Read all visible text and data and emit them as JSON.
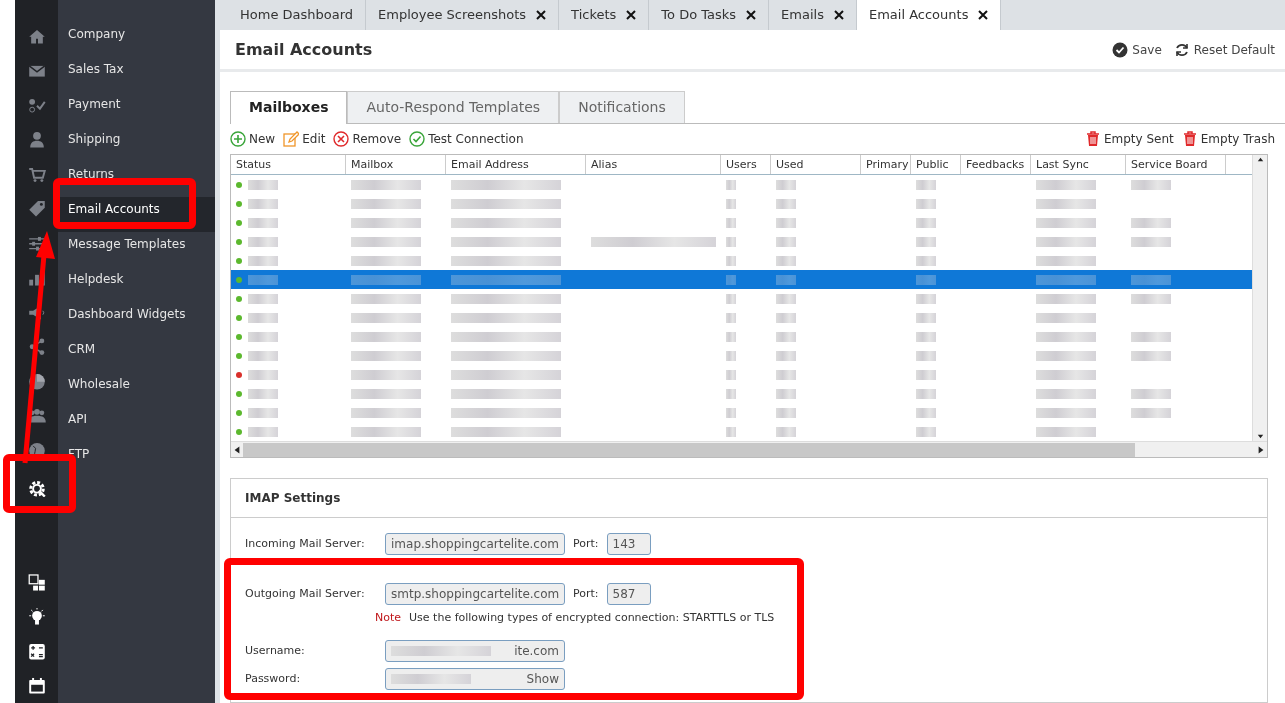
{
  "sidebar": {
    "items": [
      {
        "label": "Company",
        "selected": false
      },
      {
        "label": "Sales Tax",
        "selected": false
      },
      {
        "label": "Payment",
        "selected": false
      },
      {
        "label": "Shipping",
        "selected": false
      },
      {
        "label": "Returns",
        "selected": false
      },
      {
        "label": "Email Accounts",
        "selected": true
      },
      {
        "label": "Message Templates",
        "selected": false
      },
      {
        "label": "Helpdesk",
        "selected": false
      },
      {
        "label": "Dashboard Widgets",
        "selected": false
      },
      {
        "label": "CRM",
        "selected": false
      },
      {
        "label": "Wholesale",
        "selected": false
      },
      {
        "label": "API",
        "selected": false
      },
      {
        "label": "FTP",
        "selected": false
      }
    ]
  },
  "tabs": [
    {
      "label": "Home Dashboard",
      "selected": false,
      "closable": false
    },
    {
      "label": "Employee Screenshots",
      "selected": false,
      "closable": true
    },
    {
      "label": "Tickets",
      "selected": false,
      "closable": true
    },
    {
      "label": "To Do Tasks",
      "selected": false,
      "closable": true
    },
    {
      "label": "Emails",
      "selected": false,
      "closable": true
    },
    {
      "label": "Email Accounts",
      "selected": true,
      "closable": true
    }
  ],
  "page": {
    "title": "Email Accounts",
    "actions": [
      "Save",
      "Reset Default"
    ]
  },
  "subtabs": [
    {
      "label": "Mailboxes",
      "selected": true
    },
    {
      "label": "Auto-Respond Templates",
      "selected": false
    },
    {
      "label": "Notifications",
      "selected": false
    }
  ],
  "toolbar": {
    "left": [
      {
        "label": "New",
        "kind": "new"
      },
      {
        "label": "Edit",
        "kind": "edit"
      },
      {
        "label": "Remove",
        "kind": "remove"
      },
      {
        "label": "Test Connection",
        "kind": "test"
      }
    ],
    "right": [
      {
        "label": "Empty Sent",
        "kind": "trash"
      },
      {
        "label": "Empty Trash",
        "kind": "trash"
      }
    ]
  },
  "table": {
    "columns": [
      "Status",
      "Mailbox",
      "Email Address",
      "Alias",
      "Users",
      "Used",
      "Primary",
      "Public",
      "Feedbacks",
      "Last Sync",
      "Service Board"
    ],
    "rows": [
      {
        "color": "#5cb82e",
        "selected": false
      },
      {
        "color": "#5cb82e",
        "selected": false
      },
      {
        "color": "#5cb82e",
        "selected": false
      },
      {
        "color": "#5cb82e",
        "selected": false
      },
      {
        "color": "#5cb82e",
        "selected": false
      },
      {
        "color": "#5cb82e",
        "selected": true
      },
      {
        "color": "#5cb82e",
        "selected": false
      },
      {
        "color": "#5cb82e",
        "selected": false
      },
      {
        "color": "#5cb82e",
        "selected": false
      },
      {
        "color": "#5cb82e",
        "selected": false
      },
      {
        "color": "#d9302b",
        "selected": false
      },
      {
        "color": "#5cb82e",
        "selected": false
      },
      {
        "color": "#5cb82e",
        "selected": false
      },
      {
        "color": "#5cb82e",
        "selected": false
      }
    ]
  },
  "imap": {
    "title": "IMAP Settings",
    "incoming": {
      "label": "Incoming Mail Server:",
      "value": "imap.shoppingcartelite.com",
      "port_label": "Port:",
      "port": "143"
    },
    "outgoing": {
      "label": "Outgoing Mail Server:",
      "value": "smtp.shoppingcartelite.com",
      "port_label": "Port:",
      "port": "587"
    },
    "note_label": "Note",
    "note": "Use the following types of encrypted connection: STARTTLS or TLS",
    "username": {
      "label": "Username:",
      "value": "ite.com"
    },
    "password": {
      "label": "Password:",
      "show": "Show"
    }
  }
}
